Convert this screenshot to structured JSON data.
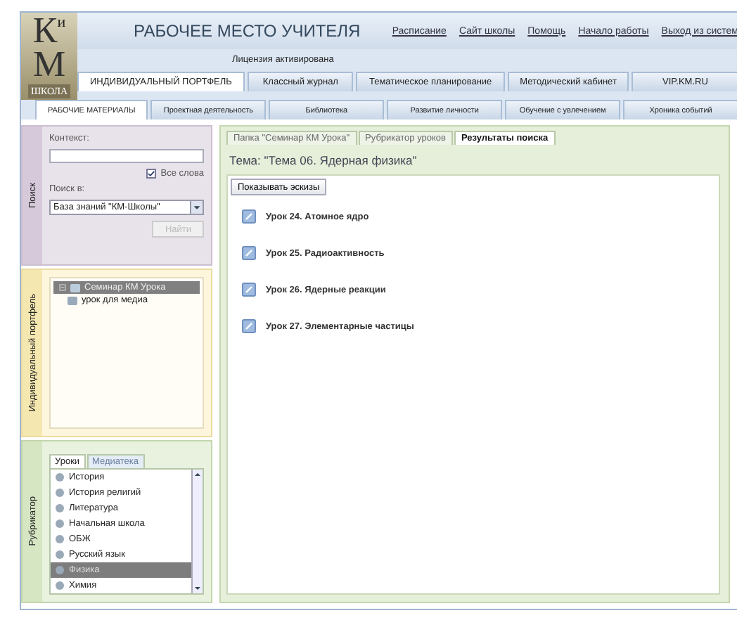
{
  "logo": {
    "letters": [
      "К",
      "и",
      "М"
    ],
    "caption": "ШКОЛА"
  },
  "header": {
    "title": "РАБОЧЕЕ МЕСТО УЧИТЕЛЯ",
    "license": "Лицензия активирована",
    "links": [
      "Расписание",
      "Сайт школы",
      "Помощь",
      "Начало работы",
      "Выход из систем"
    ]
  },
  "main_tabs": [
    {
      "label": "ИНДИВИДУАЛЬНЫЙ ПОРТФЕЛЬ",
      "selected": true
    },
    {
      "label": "Классный журнал",
      "selected": false
    },
    {
      "label": "Тематическое планирование",
      "selected": false
    },
    {
      "label": "Методический кабинет",
      "selected": false
    },
    {
      "label": "VIP.KM.RU",
      "selected": false
    }
  ],
  "sub_tabs": [
    {
      "label": "РАБОЧИЕ МАТЕРИАЛЫ",
      "selected": true
    },
    {
      "label": "Проектная деятельность",
      "selected": false
    },
    {
      "label": "Библиотека",
      "selected": false
    },
    {
      "label": "Развитие личности",
      "selected": false
    },
    {
      "label": "Обучение с увлечением",
      "selected": false
    },
    {
      "label": "Хроника событий",
      "selected": false
    }
  ],
  "search_panel": {
    "side_label": "Поиск",
    "context_label": "Контекст:",
    "all_words": {
      "label": "Все слова",
      "checked": true
    },
    "search_in_label": "Поиск в:",
    "search_in_value": "База знаний \"КМ-Школы\"",
    "find_button": {
      "label": "Найти",
      "disabled": true
    }
  },
  "portfolio_panel": {
    "side_label": "Индивидуальный портфель",
    "tree": [
      {
        "label": "Семинар КМ Урока",
        "selected": true,
        "expanded": true,
        "children": [
          {
            "label": "урок для медиа",
            "selected": false
          }
        ]
      }
    ]
  },
  "rubricator_panel": {
    "side_label": "Рубрикатор",
    "tabs": [
      {
        "label": "Уроки",
        "selected": true
      },
      {
        "label": "Медиатека",
        "selected": false
      }
    ],
    "items": [
      {
        "label": "История",
        "selected": false
      },
      {
        "label": "История религий",
        "selected": false
      },
      {
        "label": "Литература",
        "selected": false
      },
      {
        "label": "Начальная школа",
        "selected": false
      },
      {
        "label": "ОБЖ",
        "selected": false
      },
      {
        "label": "Русский язык",
        "selected": false
      },
      {
        "label": "Физика",
        "selected": true
      },
      {
        "label": "Химия",
        "selected": false
      }
    ]
  },
  "content": {
    "tabs": [
      {
        "label": "Папка \"Семинар КМ Урока\"",
        "selected": false
      },
      {
        "label": "Рубрикатор уроков",
        "selected": false
      },
      {
        "label": "Результаты поиска",
        "selected": true
      }
    ],
    "topic": "Тема: \"Тема 06. Ядерная физика\"",
    "thumbs_button": "Показывать эскизы",
    "results": [
      "Урок 24. Атомное ядро",
      "Урок 25. Радиоактивность",
      "Урок 26. Ядерные реакции",
      "Урок 27. Элементарные частицы"
    ]
  }
}
